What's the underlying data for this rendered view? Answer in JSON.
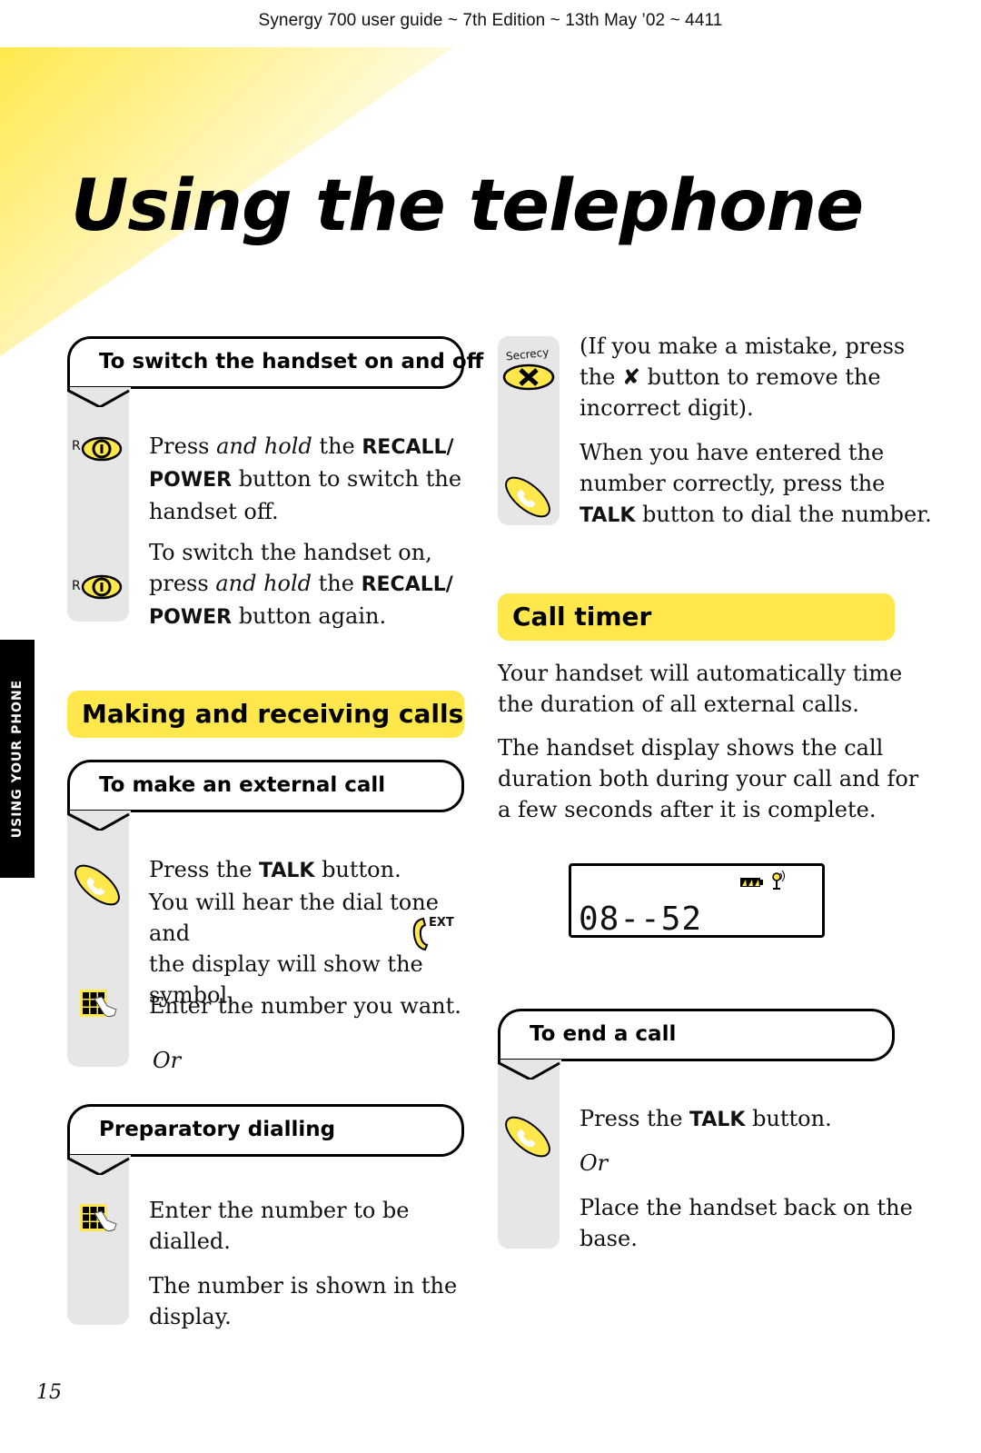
{
  "running_head": "Synergy 700 user guide ~ 7th Edition ~ 13th May ’02 ~ 4411",
  "page_title": "Using the telephone",
  "side_tab": "USING YOUR PHONE",
  "page_number": "15",
  "colors": {
    "accent_yellow": "#ffe74c",
    "gutter_grey": "#e6e6e6",
    "text": "#111111"
  },
  "left": {
    "switch_section": {
      "heading": "To switch the handset on and off",
      "steps": [
        {
          "icon": "recall-power-icon",
          "icon_prefix": "R",
          "t1": "Press ",
          "t2": "and hold",
          "t3": " the ",
          "b1": "RECALL/",
          "b2": "POWER",
          "t4": " button to switch the",
          "t5": "handset off."
        },
        {
          "icon": "recall-power-icon",
          "icon_prefix": "R",
          "t0": "To switch the handset on,",
          "t1": "press ",
          "t2": "and hold",
          "t3": " the ",
          "b1": "RECALL/",
          "b2": "POWER",
          "t4": " button again."
        }
      ]
    },
    "making_calls_heading": "Making and receiving calls",
    "external_call": {
      "heading": "To make an external call",
      "step1": {
        "t1": "Press the ",
        "b1": "TALK",
        "t2": " button.",
        "l2": "You will hear the dial tone and",
        "l3": "the display will show the",
        "ext_label": "EXT",
        "l4": "symbol."
      },
      "step2": "Enter the number you want.",
      "or": "Or"
    },
    "preparatory": {
      "heading": "Preparatory dialling",
      "p1a": "Enter the number to be",
      "p1b": "dialled.",
      "p2a": "The number is shown in the",
      "p2b": "display."
    }
  },
  "right": {
    "mistake": {
      "icon_label": "Secrecy",
      "l1": "(If you make a mistake, press",
      "l2a": "the ",
      "l2b": " button to remove the",
      "l3": "incorrect digit)."
    },
    "entered": {
      "l1": "When you have entered the",
      "l2": "number correctly, press the",
      "b": "TALK",
      "l3": " button to dial the number."
    },
    "call_timer": {
      "heading": "Call timer",
      "p1a": "Your handset will automatically time",
      "p1b": "the duration of all external calls.",
      "p2a": "The handset display shows the call",
      "p2b": "duration both during your call and for",
      "p2c": "a few seconds after it is complete.",
      "display_readout": "08--52"
    },
    "end_call": {
      "heading": "To end a call",
      "t1": "Press the ",
      "b1": "TALK",
      "t2": " button.",
      "or": "Or",
      "p2a": "Place the handset back on the",
      "p2b": "base."
    }
  }
}
